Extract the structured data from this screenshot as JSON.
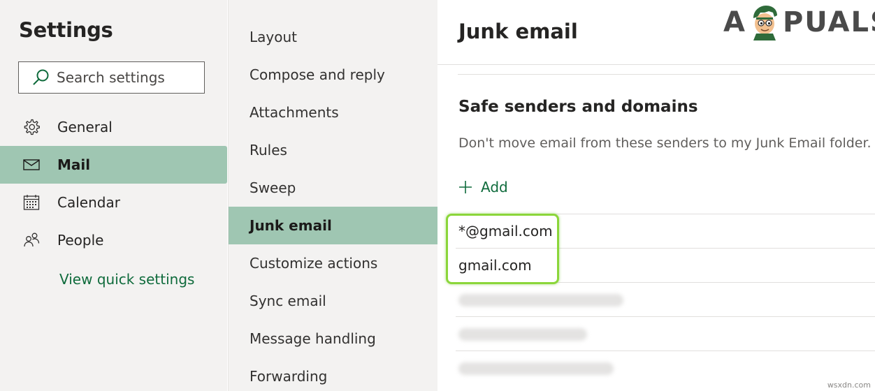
{
  "left_nav": {
    "title": "Settings",
    "search_placeholder": "Search settings",
    "items": [
      {
        "label": "General",
        "icon": "gear-icon"
      },
      {
        "label": "Mail",
        "icon": "mail-icon",
        "selected": true
      },
      {
        "label": "Calendar",
        "icon": "calendar-icon"
      },
      {
        "label": "People",
        "icon": "people-icon"
      }
    ],
    "quick_settings_label": "View quick settings"
  },
  "mid_nav": {
    "items": [
      {
        "label": "Layout"
      },
      {
        "label": "Compose and reply"
      },
      {
        "label": "Attachments"
      },
      {
        "label": "Rules"
      },
      {
        "label": "Sweep"
      },
      {
        "label": "Junk email",
        "selected": true
      },
      {
        "label": "Customize actions"
      },
      {
        "label": "Sync email"
      },
      {
        "label": "Message handling"
      },
      {
        "label": "Forwarding"
      }
    ]
  },
  "content": {
    "title": "Junk email",
    "section_title": "Safe senders and domains",
    "section_description": "Don't move email from these senders to my Junk Email folder.",
    "add_label": "Add",
    "senders": [
      "*@gmail.com",
      "gmail.com"
    ]
  },
  "logo": {
    "left": "A",
    "right": "PUALS"
  },
  "watermark": "wsxdn.com",
  "colors": {
    "selected_bg": "#9fc6b2",
    "accent_green": "#0f6b3c",
    "nav_bg": "#f3f2f1",
    "highlight": "#8bd63a"
  }
}
